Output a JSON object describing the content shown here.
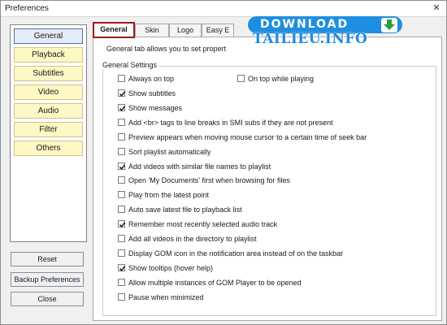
{
  "window": {
    "title": "Preferences"
  },
  "sidebar": {
    "items": [
      {
        "label": "General",
        "active": true
      },
      {
        "label": "Playback",
        "active": false
      },
      {
        "label": "Subtitles",
        "active": false
      },
      {
        "label": "Video",
        "active": false
      },
      {
        "label": "Audio",
        "active": false
      },
      {
        "label": "Filter",
        "active": false
      },
      {
        "label": "Others",
        "active": false
      }
    ],
    "buttons": {
      "reset": "Reset",
      "backup": "Backup Preferences",
      "close": "Close"
    }
  },
  "tabs": [
    {
      "label": "General",
      "active": true
    },
    {
      "label": "Skin",
      "active": false
    },
    {
      "label": "Logo",
      "active": false
    },
    {
      "label": "Easy E",
      "active": false
    }
  ],
  "general": {
    "description": "General tab allows you to set propert",
    "group_label": "General Settings",
    "options": [
      {
        "label": "Always on top",
        "checked": false
      },
      {
        "label": "On top while playing",
        "checked": false
      },
      {
        "label": "Show subtitles",
        "checked": true
      },
      {
        "label": "Show messages",
        "checked": true
      },
      {
        "label": "Add <br> tags to line breaks in SMI subs if they are not present",
        "checked": false
      },
      {
        "label": "Preview appears when moving mouse cursor to a certain time of seek bar",
        "checked": false
      },
      {
        "label": "Sort playlist automatically",
        "checked": false
      },
      {
        "label": "Add videos with similar file names to playlist",
        "checked": true
      },
      {
        "label": "Open 'My Documents' first when browsing for files",
        "checked": false
      },
      {
        "label": "Play from the latest point",
        "checked": false
      },
      {
        "label": "Auto save latest file to playback list",
        "checked": false
      },
      {
        "label": "Remember most recently selected audio track",
        "checked": true
      },
      {
        "label": "Add all videos in the directory to playlist",
        "checked": false
      },
      {
        "label": "Display GOM icon in the notification area instead of on the taskbar",
        "checked": false
      },
      {
        "label": "Show tooltips (hover help)",
        "checked": true
      },
      {
        "label": "Allow multiple instances of GOM Player to be opened",
        "checked": false
      },
      {
        "label": "Pause when minimized",
        "checked": false
      }
    ]
  },
  "watermark": {
    "line1": "DOWNLOAD",
    "line2": "TAILIEU.INFO"
  },
  "colors": {
    "active_tab_border": "#9c1b1b",
    "sidebar_item_bg": "#fff7c4",
    "watermark_blue": "#1e8fe0"
  },
  "icons": {
    "checkmark": "check-icon",
    "download_arrow": "arrow-down-icon",
    "window_close": "close-icon"
  }
}
